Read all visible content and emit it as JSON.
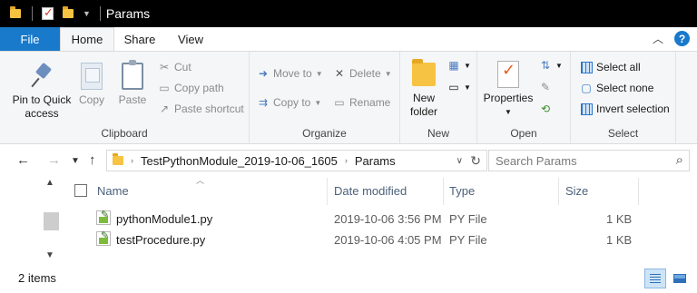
{
  "window": {
    "title": "Params"
  },
  "ribbon_tabs": {
    "file": "File",
    "home": "Home",
    "share": "Share",
    "view": "View"
  },
  "clipboard": {
    "pin": "Pin to Quick access",
    "copy": "Copy",
    "paste": "Paste",
    "cut": "Cut",
    "copy_path": "Copy path",
    "paste_shortcut": "Paste shortcut",
    "label": "Clipboard"
  },
  "organize": {
    "move_to": "Move to",
    "copy_to": "Copy to",
    "delete": "Delete",
    "rename": "Rename",
    "label": "Organize"
  },
  "new_group": {
    "new_folder_line1": "New",
    "new_folder_line2": "folder",
    "label": "New"
  },
  "open_group": {
    "properties": "Properties",
    "label": "Open"
  },
  "select_group": {
    "select_all": "Select all",
    "select_none": "Select none",
    "invert_selection": "Invert selection",
    "label": "Select"
  },
  "address": {
    "segments": [
      "TestPythonModule_2019-10-06_1605",
      "Params"
    ]
  },
  "search": {
    "placeholder": "Search Params"
  },
  "columns": {
    "name": "Name",
    "date_modified": "Date modified",
    "type": "Type",
    "size": "Size"
  },
  "files": [
    {
      "name": "pythonModule1.py",
      "date": "2019-10-06 3:56 PM",
      "type": "PY File",
      "size": "1 KB"
    },
    {
      "name": "testProcedure.py",
      "date": "2019-10-06 4:05 PM",
      "type": "PY File",
      "size": "1 KB"
    }
  ],
  "status": {
    "item_count": "2 items"
  }
}
